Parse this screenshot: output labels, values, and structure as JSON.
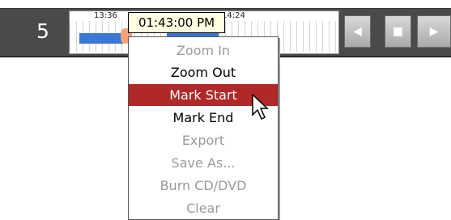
{
  "channel": {
    "number": "5"
  },
  "timeline": {
    "labels": [
      "13:36",
      "14:24"
    ],
    "tooltip_time": "01:43:00 PM"
  },
  "nav": {
    "prev_icon": "prev-icon",
    "stop_icon": "stop-icon",
    "next_icon": "next-icon"
  },
  "menu": {
    "items": [
      {
        "label": "Zoom In",
        "enabled": false
      },
      {
        "label": "Zoom Out",
        "enabled": true
      },
      {
        "label": "Mark Start",
        "enabled": true,
        "highlighted": true
      },
      {
        "label": "Mark End",
        "enabled": true
      },
      {
        "label": "Export",
        "enabled": false
      },
      {
        "label": "Save As...",
        "enabled": false
      },
      {
        "label": "Burn CD/DVD",
        "enabled": false
      },
      {
        "label": "Clear",
        "enabled": false
      }
    ]
  },
  "colors": {
    "highlight": "#b02828",
    "recording_bar": "#3a77d6",
    "strip": "#4a4a4a"
  }
}
